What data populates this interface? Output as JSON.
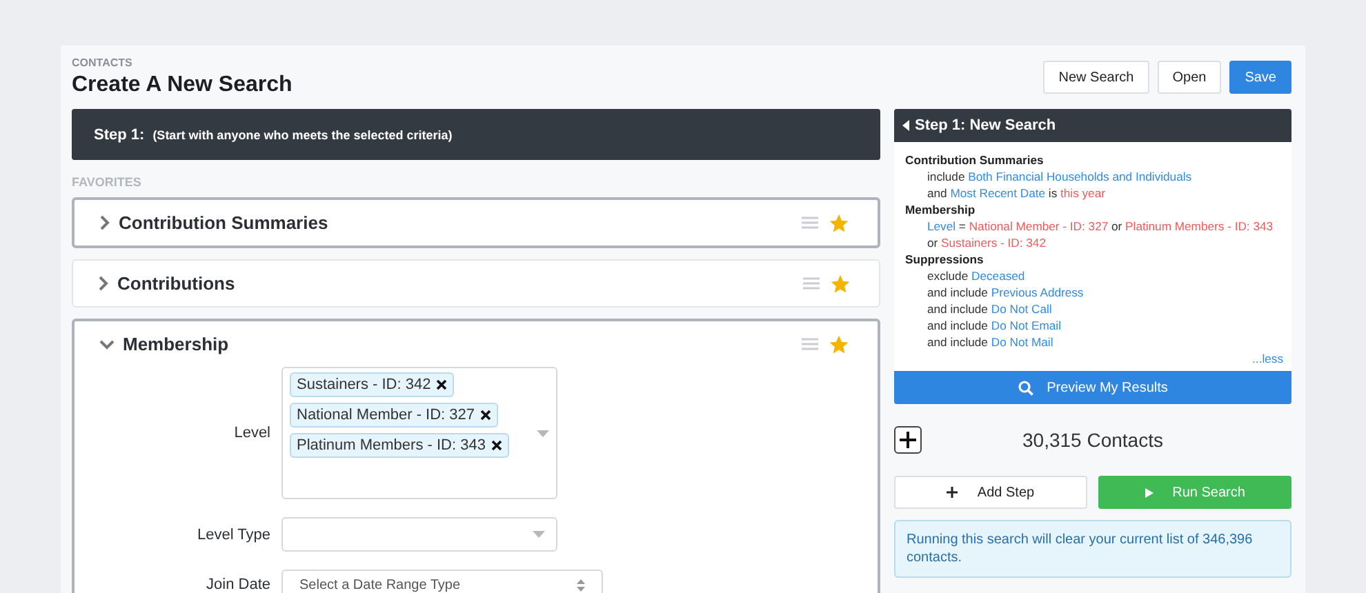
{
  "header": {
    "breadcrumb": "CONTACTS",
    "title": "Create A New Search",
    "buttons": [
      {
        "label": "New Search",
        "primary": false
      },
      {
        "label": "Open",
        "primary": false
      },
      {
        "label": "Save",
        "primary": true
      }
    ]
  },
  "step_bar": {
    "label": "Step 1:",
    "description": "(Start with anyone who meets the selected criteria)"
  },
  "favorites": {
    "heading": "FAVORITES",
    "sections": [
      {
        "title": "Contribution Summaries",
        "expanded": false,
        "starred": true,
        "focused": true
      },
      {
        "title": "Contributions",
        "expanded": false,
        "starred": true,
        "focused": false
      },
      {
        "title": "Membership",
        "expanded": true,
        "starred": true,
        "focused": true,
        "fields": [
          {
            "label": "Level",
            "kind": "multiselect",
            "tags": [
              "Sustainers - ID: 342",
              "National Member - ID: 327",
              "Platinum Members - ID: 343"
            ]
          },
          {
            "label": "Level Type",
            "kind": "select"
          },
          {
            "label": "Join Date",
            "kind": "range",
            "placeholder": "Select a Date Range Type"
          }
        ]
      }
    ]
  },
  "summary": {
    "title": "Step 1: New Search",
    "groups": [
      {
        "heading": "Contribution Summaries",
        "lines": [
          [
            {
              "text": "include ",
              "kind": "plain"
            },
            {
              "text": "Both Financial Households and Individuals",
              "kind": "field"
            }
          ],
          [
            {
              "text": "and ",
              "kind": "plain"
            },
            {
              "text": "Most Recent Date",
              "kind": "field"
            },
            {
              "text": " is ",
              "kind": "plain"
            },
            {
              "text": "this year",
              "kind": "value"
            }
          ]
        ]
      },
      {
        "heading": "Membership",
        "lines": [
          [
            {
              "text": "Level",
              "kind": "field"
            },
            {
              "text": " = ",
              "kind": "plain"
            },
            {
              "text": "National Member - ID: 327",
              "kind": "value"
            },
            {
              "text": " or ",
              "kind": "plain"
            },
            {
              "text": "Platinum Members - ID: 343",
              "kind": "value"
            }
          ],
          [
            {
              "text": "or ",
              "kind": "plain"
            },
            {
              "text": "Sustainers - ID: 342",
              "kind": "value"
            }
          ]
        ]
      },
      {
        "heading": "Suppressions",
        "lines": [
          [
            {
              "text": "exclude ",
              "kind": "plain"
            },
            {
              "text": "Deceased",
              "kind": "field"
            }
          ],
          [
            {
              "text": "and include ",
              "kind": "plain"
            },
            {
              "text": "Previous Address",
              "kind": "field"
            }
          ],
          [
            {
              "text": "and include ",
              "kind": "plain"
            },
            {
              "text": "Do Not Call",
              "kind": "field"
            }
          ],
          [
            {
              "text": "and include ",
              "kind": "plain"
            },
            {
              "text": "Do Not Email",
              "kind": "field"
            }
          ],
          [
            {
              "text": "and include ",
              "kind": "plain"
            },
            {
              "text": "Do Not Mail",
              "kind": "field"
            }
          ]
        ]
      }
    ],
    "less_link": "...less",
    "preview_button": "Preview My Results"
  },
  "results": {
    "count": "30,315 Contacts",
    "add_step": "Add Step",
    "run_search": "Run Search",
    "notice": "Running this search will clear your current list of 346,396 contacts."
  }
}
